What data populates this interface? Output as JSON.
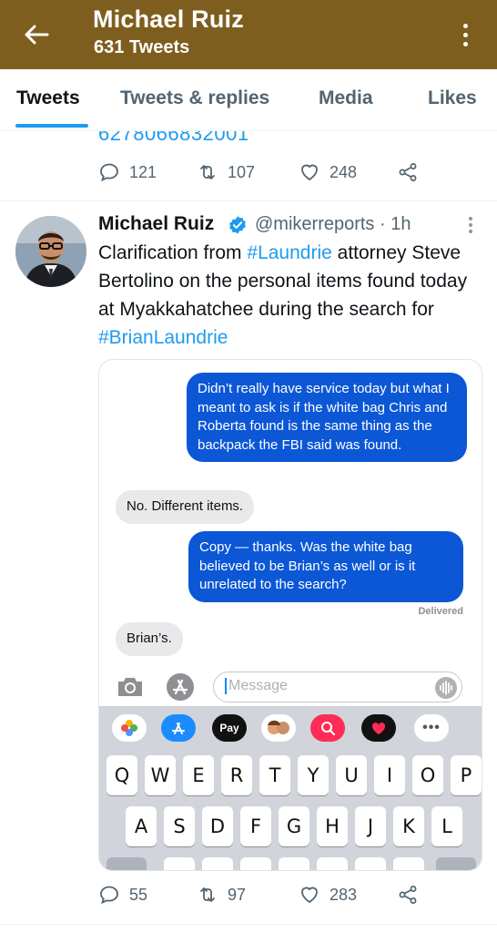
{
  "header": {
    "title": "Michael Ruiz",
    "subtitle": "631 Tweets"
  },
  "tabs": [
    {
      "label": "Tweets",
      "active": true
    },
    {
      "label": "Tweets & replies",
      "active": false
    },
    {
      "label": "Media",
      "active": false
    },
    {
      "label": "Likes",
      "active": false
    }
  ],
  "prev_tweet": {
    "link_fragment": "6278066832001",
    "replies": "121",
    "retweets": "107",
    "likes": "248"
  },
  "tweet": {
    "name": "Michael Ruiz",
    "handle": "@mikerreports · 1h",
    "text_1": "Clarification from ",
    "hashtag_1": "#Laundrie",
    "text_2": " attorney Steve Bertolino on the personal items found today at Myakkahatchee during the search for ",
    "hashtag_2": "#BrianLaundrie",
    "replies": "55",
    "retweets": "97",
    "likes": "283"
  },
  "screenshot": {
    "messages": [
      {
        "from": "me",
        "text": "Didn’t really have service today but what I meant to ask is if the white bag Chris and Roberta found is the same thing as the backpack the FBI said was found."
      },
      {
        "from": "them",
        "text": "No.  Different items."
      },
      {
        "from": "me",
        "text": "Copy — thanks. Was the white bag believed to be Brian’s as well or is it unrelated to the search?"
      },
      {
        "from": "them",
        "text": "Brian’s."
      }
    ],
    "delivered": "Delivered",
    "input_placeholder": "Message",
    "apple_pay": "Pay",
    "keys_row1": [
      "Q",
      "W",
      "E",
      "R",
      "T",
      "Y",
      "U",
      "I",
      "O",
      "P"
    ],
    "keys_row2": [
      "A",
      "S",
      "D",
      "F",
      "G",
      "H",
      "J",
      "K",
      "L"
    ]
  },
  "colors": {
    "header_bg": "#7e5e1e",
    "accent": "#1d9bf0",
    "imessage_blue": "#0b57d6"
  },
  "icons": [
    "back-arrow-icon",
    "more-vertical-icon",
    "reply-icon",
    "retweet-icon",
    "like-icon",
    "share-icon",
    "verified-badge-icon",
    "camera-icon",
    "app-store-icon",
    "audio-icon"
  ]
}
